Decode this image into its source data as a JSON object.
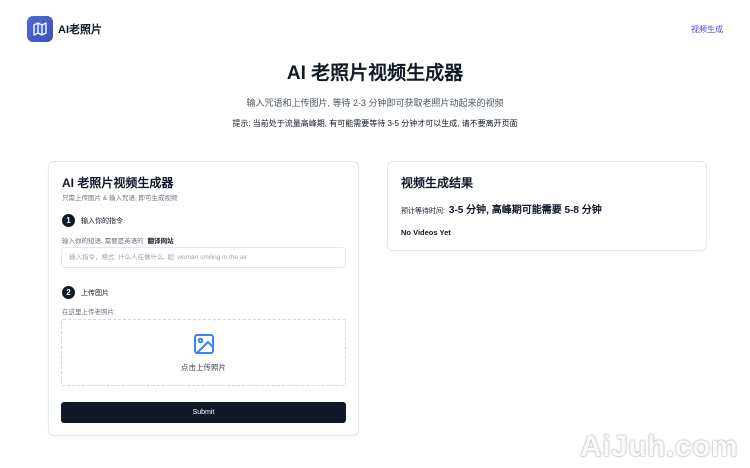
{
  "header": {
    "brand": "AI老照片",
    "nav_link": "视频生成"
  },
  "hero": {
    "title": "AI 老照片视频生成器",
    "subtitle": "输入咒语和上传图片, 等待 2-3 分钟即可获取老照片动起来的视频",
    "notice": "提示: 当前处于流量高峰期, 有可能需要等待 3-5 分钟才可以生成, 请不要离开页面"
  },
  "form": {
    "title": "AI 老照片视频生成器",
    "desc": "只需上传图片 & 输入咒语, 即可生成视频",
    "step1": {
      "number": "1",
      "label": "输入你的指令",
      "hint": "输入你的短语, 需要是英语的",
      "hint_link": "翻译网站",
      "placeholder": "输入指令，格式: 什么人在做什么, 如: woman smiling in the air"
    },
    "step2": {
      "number": "2",
      "label": "上传图片",
      "hint": "在这里上传老照片",
      "upload_label": "点击上传照片"
    },
    "submit_label": "Submit"
  },
  "result": {
    "title": "视频生成结果",
    "wait_label": "预计等待时间:",
    "wait_value": "3-5 分钟, 高峰期可能需要 5-8 分钟",
    "empty": "No Videos Yet"
  },
  "watermark": "AiJuh.com",
  "colors": {
    "primary": "#111827",
    "accent": "#4f46e5",
    "logo": "#4f6bd9",
    "upload_icon": "#3b82f6"
  }
}
